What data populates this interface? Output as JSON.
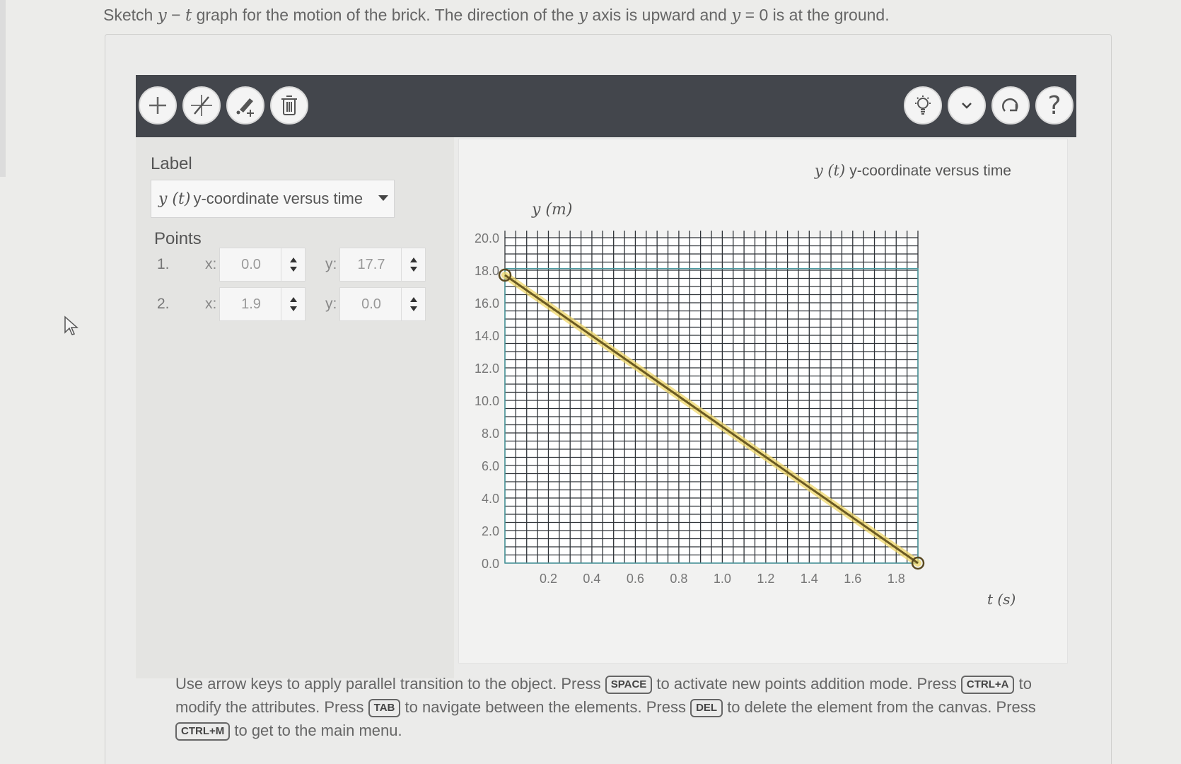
{
  "question": {
    "p1": "Sketch ",
    "v1": "y",
    "p2": " − ",
    "v2": "t",
    "p3": " graph for the motion of the brick. The direction of the ",
    "v3": "y",
    "p4": " axis is upward and ",
    "v4": "y",
    "p5": " = ",
    "v5": "0",
    "p6": " is at the ground."
  },
  "toolbar": {
    "left_icons": [
      "plus-icon",
      "line-tool-icon",
      "point-pen-icon",
      "trash-icon"
    ],
    "right_icons": [
      "lightbulb-icon",
      "chevron-down-icon",
      "redo-icon",
      "help-icon"
    ],
    "help_glyph": "?"
  },
  "sidebar": {
    "label_heading": "Label",
    "dropdown": {
      "var": "y (t)",
      "text": "y-coordinate versus time"
    },
    "points_heading": "Points",
    "x_label": "x:",
    "y_label": "y:",
    "points": [
      {
        "num": "1.",
        "x": "0.0",
        "y": "17.7"
      },
      {
        "num": "2.",
        "x": "1.9",
        "y": "0.0"
      }
    ]
  },
  "chart_data": {
    "type": "line",
    "title_var": "y (t)",
    "title_text": "y-coordinate versus time",
    "ylabel": "y (m)",
    "xlabel": "t (s)",
    "xlim": [
      0,
      1.9
    ],
    "ylim": [
      0,
      20
    ],
    "x_ticks": [
      "0.2",
      "0.4",
      "0.6",
      "0.8",
      "1.0",
      "1.2",
      "1.4",
      "1.6",
      "1.8"
    ],
    "y_ticks": [
      "0.0",
      "2.0",
      "4.0",
      "6.0",
      "8.0",
      "10.0",
      "12.0",
      "14.0",
      "16.0",
      "18.0",
      "20.0"
    ],
    "grid": true,
    "series": [
      {
        "points": [
          {
            "x": 0.0,
            "y": 17.7
          },
          {
            "x": 1.9,
            "y": 0.0
          }
        ],
        "color": "#d6b23a"
      }
    ]
  },
  "instructions": {
    "t1": "Use arrow keys to apply parallel transition to the object. Press ",
    "k1": "SPACE",
    "t2": " to activate new points addition mode. Press ",
    "k2": "CTRL+A",
    "t3": " to modify the attributes. Press ",
    "k3": "TAB",
    "t4": " to navigate between the elements. Press ",
    "k4": "DEL",
    "t5": " to delete the element from the canvas. Press ",
    "k5": "CTRL+M",
    "t6": " to get to the main menu."
  }
}
